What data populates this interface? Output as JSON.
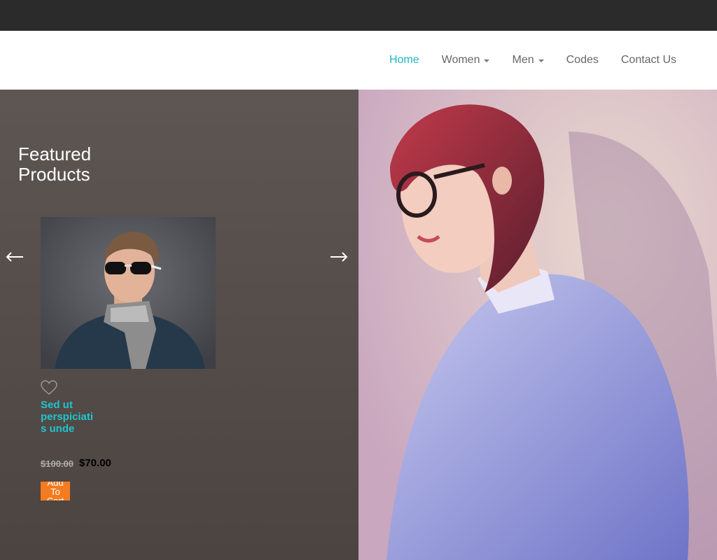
{
  "nav": {
    "items": [
      {
        "label": "Home",
        "active": true,
        "dropdown": false
      },
      {
        "label": "Women",
        "active": false,
        "dropdown": true
      },
      {
        "label": "Men",
        "active": false,
        "dropdown": true
      },
      {
        "label": "Codes",
        "active": false,
        "dropdown": false
      },
      {
        "label": "Contact Us",
        "active": false,
        "dropdown": false
      }
    ]
  },
  "featured": {
    "title": "Featured Products",
    "prev_icon": "arrow-left-icon",
    "next_icon": "arrow-right-icon"
  },
  "product": {
    "name": "Sed ut perspiciatis unde",
    "price_old": "$100.00",
    "price_new": "$70.00",
    "cart_label": "Add To Cart",
    "wishlist_icon": "heart-outline-icon"
  },
  "colors": {
    "accent": "#1fb5c2",
    "cart_button": "#f47b20",
    "topbar": "#2b2b2b"
  }
}
